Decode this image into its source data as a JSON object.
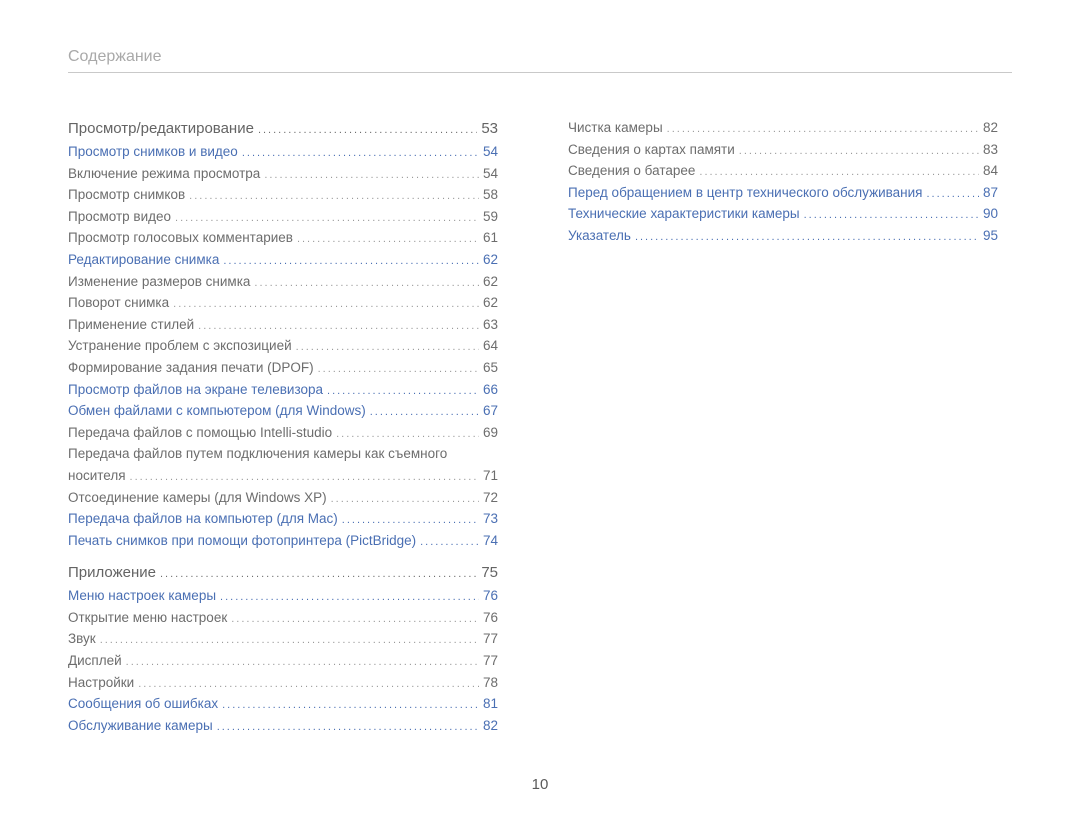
{
  "header": "Содержание",
  "page_number": "10",
  "columns": [
    [
      {
        "label": "Просмотр/редактирование",
        "page": "53",
        "kind": "section"
      },
      {
        "label": "Просмотр снимков и видео",
        "page": "54",
        "kind": "link"
      },
      {
        "label": "Включение режима просмотра",
        "page": "54",
        "kind": "plain"
      },
      {
        "label": "Просмотр снимков",
        "page": "58",
        "kind": "plain"
      },
      {
        "label": "Просмотр видео",
        "page": "59",
        "kind": "plain"
      },
      {
        "label": "Просмотр голосовых комментариев",
        "page": "61",
        "kind": "plain"
      },
      {
        "label": "Редактирование снимка",
        "page": "62",
        "kind": "link"
      },
      {
        "label": "Изменение размеров снимка",
        "page": "62",
        "kind": "plain"
      },
      {
        "label": "Поворот снимка",
        "page": "62",
        "kind": "plain"
      },
      {
        "label": "Применение стилей",
        "page": "63",
        "kind": "plain"
      },
      {
        "label": "Устранение проблем с экспозицией",
        "page": "64",
        "kind": "plain"
      },
      {
        "label": "Формирование задания печати (DPOF)",
        "page": "65",
        "kind": "plain"
      },
      {
        "label": "Просмотр файлов на экране телевизора",
        "page": "66",
        "kind": "link"
      },
      {
        "label": "Обмен файлами с компьютером (для Windows)",
        "page": "67",
        "kind": "link"
      },
      {
        "label": "Передача файлов с помощью Intelli-studio",
        "page": "69",
        "kind": "plain"
      },
      {
        "label": "Передача файлов путем подключения камеры как съемного носителя",
        "page": "71",
        "kind": "plain",
        "wrap": true
      },
      {
        "label": "Отсоединение камеры (для Windows XP)",
        "page": "72",
        "kind": "plain"
      },
      {
        "label": "Передача файлов на компьютер (для Mac)",
        "page": "73",
        "kind": "link"
      },
      {
        "label": "Печать снимков при помощи фотопринтера (PictBridge)",
        "page": "74",
        "kind": "link"
      },
      {
        "label": "Приложение",
        "page": "75",
        "kind": "section"
      },
      {
        "label": "Меню настроек камеры",
        "page": "76",
        "kind": "link"
      },
      {
        "label": "Открытие меню настроек",
        "page": "76",
        "kind": "plain"
      },
      {
        "label": "Звук",
        "page": "77",
        "kind": "plain"
      },
      {
        "label": "Дисплей",
        "page": "77",
        "kind": "plain"
      },
      {
        "label": "Настройки",
        "page": "78",
        "kind": "plain"
      },
      {
        "label": "Сообщения об ошибках",
        "page": "81",
        "kind": "link"
      },
      {
        "label": "Обслуживание камеры",
        "page": "82",
        "kind": "link"
      }
    ],
    [
      {
        "label": "Чистка камеры",
        "page": "82",
        "kind": "plain"
      },
      {
        "label": "Сведения о картах памяти",
        "page": "83",
        "kind": "plain"
      },
      {
        "label": "Сведения о батарее",
        "page": "84",
        "kind": "plain"
      },
      {
        "label": "Перед обращением в центр технического обслуживания",
        "page": "87",
        "kind": "link"
      },
      {
        "label": "Технические характеристики камеры",
        "page": "90",
        "kind": "link"
      },
      {
        "label": "Указатель",
        "page": "95",
        "kind": "link"
      }
    ]
  ]
}
